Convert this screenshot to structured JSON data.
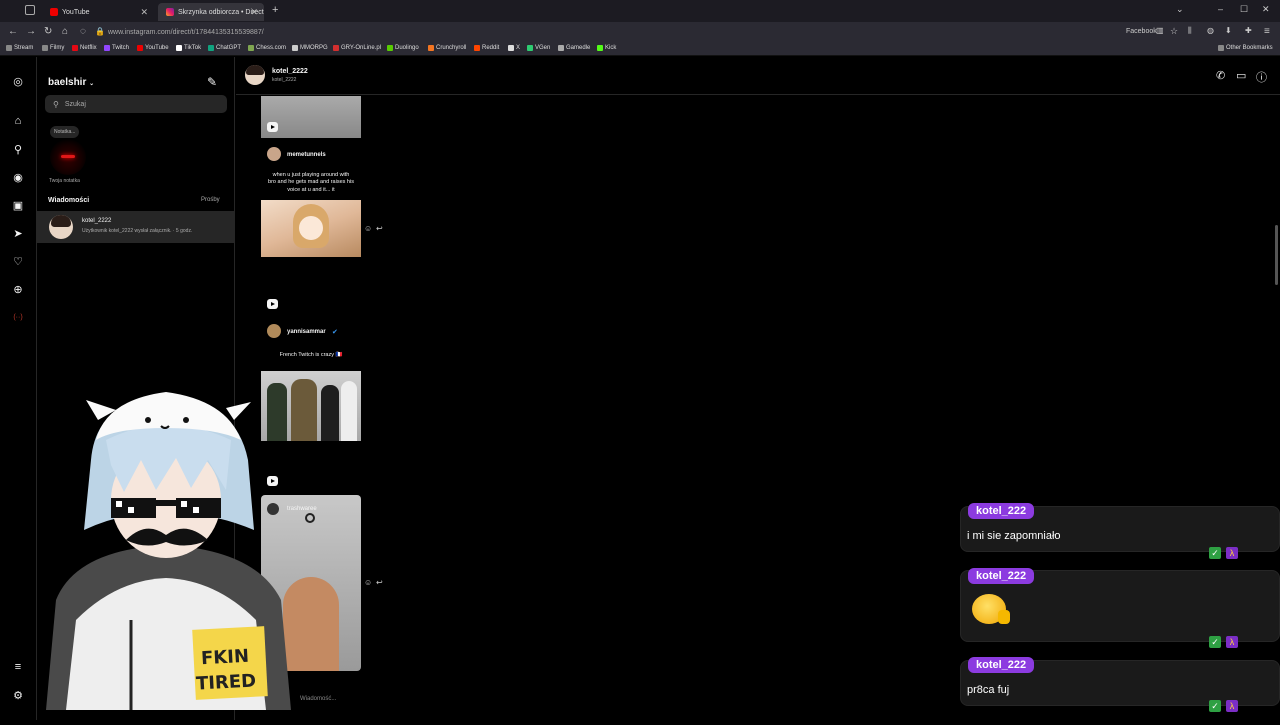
{
  "browser": {
    "tabs": [
      {
        "label": "YouTube",
        "active": false
      },
      {
        "label": "Skrzynka odbiorcza • Direct",
        "active": true
      }
    ],
    "url": "www.instagram.com/direct/t/17844135315539887/",
    "bookmarks": [
      "Stream",
      "Filmy",
      "Netflix",
      "Twitch",
      "YouTube",
      "TikTok",
      "ChatGPT",
      "Chess.com",
      "MMORPG",
      "GRY-OnLine.pl",
      "Duolingo",
      "Crunchyroll",
      "Reddit",
      "X",
      "VGen",
      "Gamedle",
      "Kick"
    ],
    "other_bookmarks": "Other Bookmarks",
    "facebook_container": "Facebook",
    "window_controls": [
      "–",
      "☐",
      "✕"
    ]
  },
  "inbox": {
    "username": "baelshir",
    "search_placeholder": "Szukaj",
    "note_bubble": "Notatka...",
    "note_label": "Twoja notatka",
    "messages_heading": "Wiadomości",
    "requests": "Prośby",
    "thread": {
      "name": "kotel_2222",
      "preview": "Użytkownik kotel_2222 wysłał załącznik. · 5 godz."
    }
  },
  "chat": {
    "name": "kotel_2222",
    "subname": "kotel_2222",
    "input_placeholder": "Wiadomość..."
  },
  "posts": [
    {
      "poster": "memetunnels",
      "caption": "when u just playing around with bro and he gets mad and raises his voice at u and it... it"
    },
    {
      "poster": "yannisammar",
      "verified": true,
      "caption": "French Twitch is crazy 🇫🇷"
    },
    {
      "poster": "trashwaree",
      "caption": ""
    }
  ],
  "stream_chat": [
    {
      "user": "kotel_222",
      "text": "i mi sie zapomniało"
    },
    {
      "user": "kotel_222",
      "text": "",
      "emote": "thumbs-up-emote"
    },
    {
      "user": "kotel_222",
      "text": "pr8ca fuj"
    }
  ],
  "vtuber": {
    "sign_line1": "FKIN",
    "sign_line2": "TIRED"
  },
  "colors": {
    "accent": "#8c3be0",
    "bg": "#000000",
    "panel": "#262626"
  }
}
